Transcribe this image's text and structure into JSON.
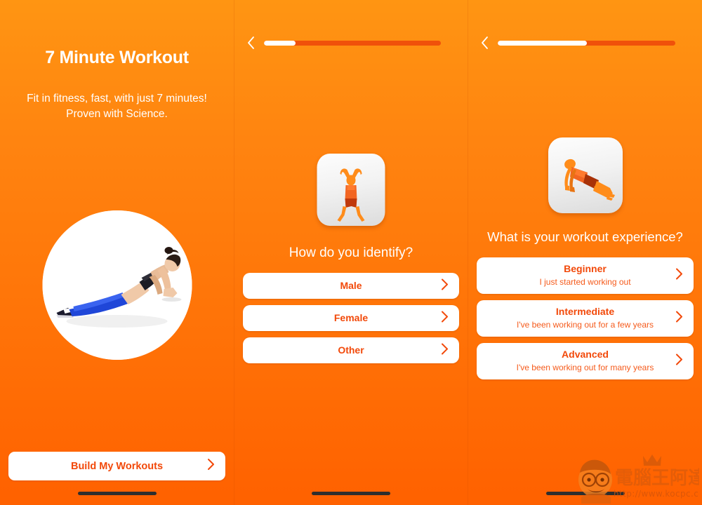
{
  "app": {
    "title": "7 Minute Workout",
    "subtitle": "Fit in fitness, fast, with just 7 minutes!\nProven with Science.",
    "accent_orange": "#ff8410",
    "accent_red": "#f2490a",
    "button_bg": "#ffffff"
  },
  "screen_welcome": {
    "hero_icon": "woman-plank-photo",
    "cta_label": "Build My Workouts",
    "cta_chevron": "chevron-right-icon",
    "home_indicator": "home-indicator"
  },
  "screen_identity": {
    "back_icon": "chevron-left-icon",
    "progress_percent": 18,
    "icon": "jumping-jack-icon",
    "heading": "How do you identify?",
    "options": [
      {
        "label": "Male",
        "chevron": "chevron-right-icon"
      },
      {
        "label": "Female",
        "chevron": "chevron-right-icon"
      },
      {
        "label": "Other",
        "chevron": "chevron-right-icon"
      }
    ],
    "home_indicator": "home-indicator"
  },
  "screen_experience": {
    "back_icon": "chevron-left-icon",
    "progress_percent": 50,
    "icon": "push-up-icon",
    "heading": "What is your workout experience?",
    "options": [
      {
        "label": "Beginner",
        "description": "I just started working out",
        "chevron": "chevron-right-icon"
      },
      {
        "label": "Intermediate",
        "description": "I've been working out for a few years",
        "chevron": "chevron-right-icon"
      },
      {
        "label": "Advanced",
        "description": "I've been working out for many years",
        "chevron": "chevron-right-icon"
      }
    ],
    "home_indicator": "home-indicator"
  },
  "watermark": {
    "brand": "電腦王阿達",
    "url": "http://www.kocpc.com.tw",
    "mascot": "mascot-face-icon"
  }
}
